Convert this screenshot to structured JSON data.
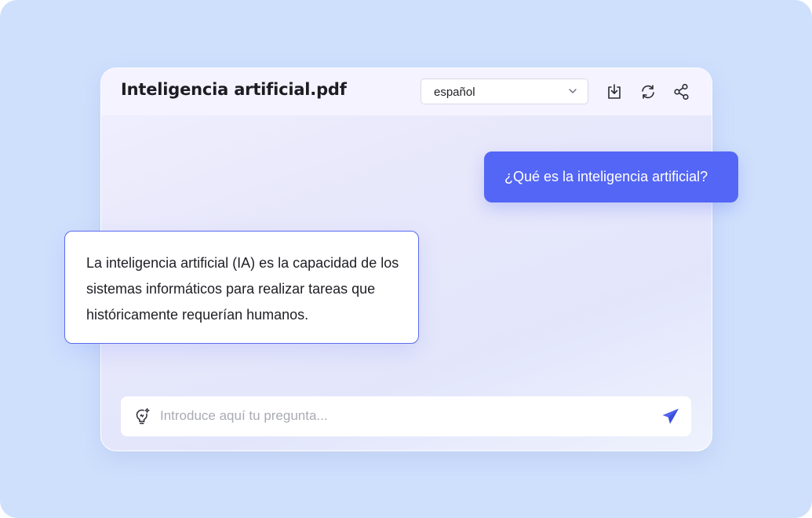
{
  "document": {
    "title": "Inteligencia artificial.pdf"
  },
  "language_select": {
    "value": "español"
  },
  "header_actions": [
    {
      "icon": "download-icon"
    },
    {
      "icon": "refresh-icon"
    },
    {
      "icon": "share-icon"
    }
  ],
  "chat": {
    "user_message": "¿Qué es la inteligencia artificial?",
    "bot_message": "La inteligencia artificial (IA) es la capacidad de los sistemas informáticos para realizar tareas que históricamente requerían humanos."
  },
  "input": {
    "placeholder": "Introduce aquí tu pregunta...",
    "value": "",
    "left_icon": "lightbulb-sparkle-icon",
    "send_icon": "send-icon"
  },
  "colors": {
    "background": "#cfe0fd",
    "accent": "#5466f5",
    "bot_border": "#5a6cf0",
    "title_text": "#1c1c22"
  }
}
